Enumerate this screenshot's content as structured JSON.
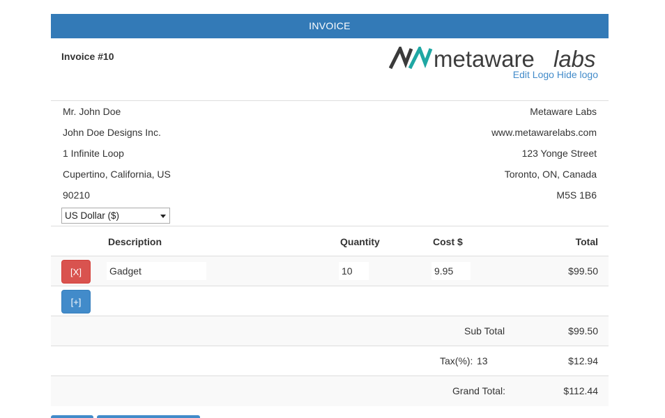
{
  "banner": {
    "title": "INVOICE"
  },
  "invoice": {
    "label": "Invoice #",
    "number": "10"
  },
  "logo": {
    "text_meta": "metaware",
    "text_labs": "labs",
    "edit_label": "Edit Logo",
    "hide_label": "Hide logo",
    "colors": {
      "mark_dark": "#3a3a3a",
      "mark_teal": "#1fa7a3",
      "text_dark": "#3d3d3d"
    }
  },
  "client": {
    "name": "Mr. John Doe",
    "company": "John Doe Designs Inc.",
    "street": "1 Infinite Loop",
    "city": "Cupertino, California, US",
    "postal": "90210"
  },
  "company": {
    "name": "Metaware Labs",
    "website": "www.metawarelabs.com",
    "street": "123 Yonge Street",
    "city": "Toronto, ON, Canada",
    "postal": "M5S 1B6"
  },
  "currency": {
    "selected": "US Dollar ($)"
  },
  "table": {
    "headers": {
      "description": "Description",
      "quantity": "Quantity",
      "cost": "Cost $",
      "total": "Total"
    },
    "items": [
      {
        "remove_label": "[X]",
        "description": "Gadget",
        "quantity": "10",
        "cost": "9.95",
        "total": "$99.50"
      }
    ],
    "add_label": "[+]"
  },
  "totals": {
    "subtotal_label": "Sub Total",
    "subtotal_value": "$99.50",
    "tax_label": "Tax(%):",
    "tax_rate": "13",
    "tax_value": "$12.94",
    "grand_label": "Grand Total:",
    "grand_value": "$112.44"
  },
  "colors": {
    "primary": "#337ab7",
    "danger": "#d9534f",
    "link": "#428bca"
  }
}
